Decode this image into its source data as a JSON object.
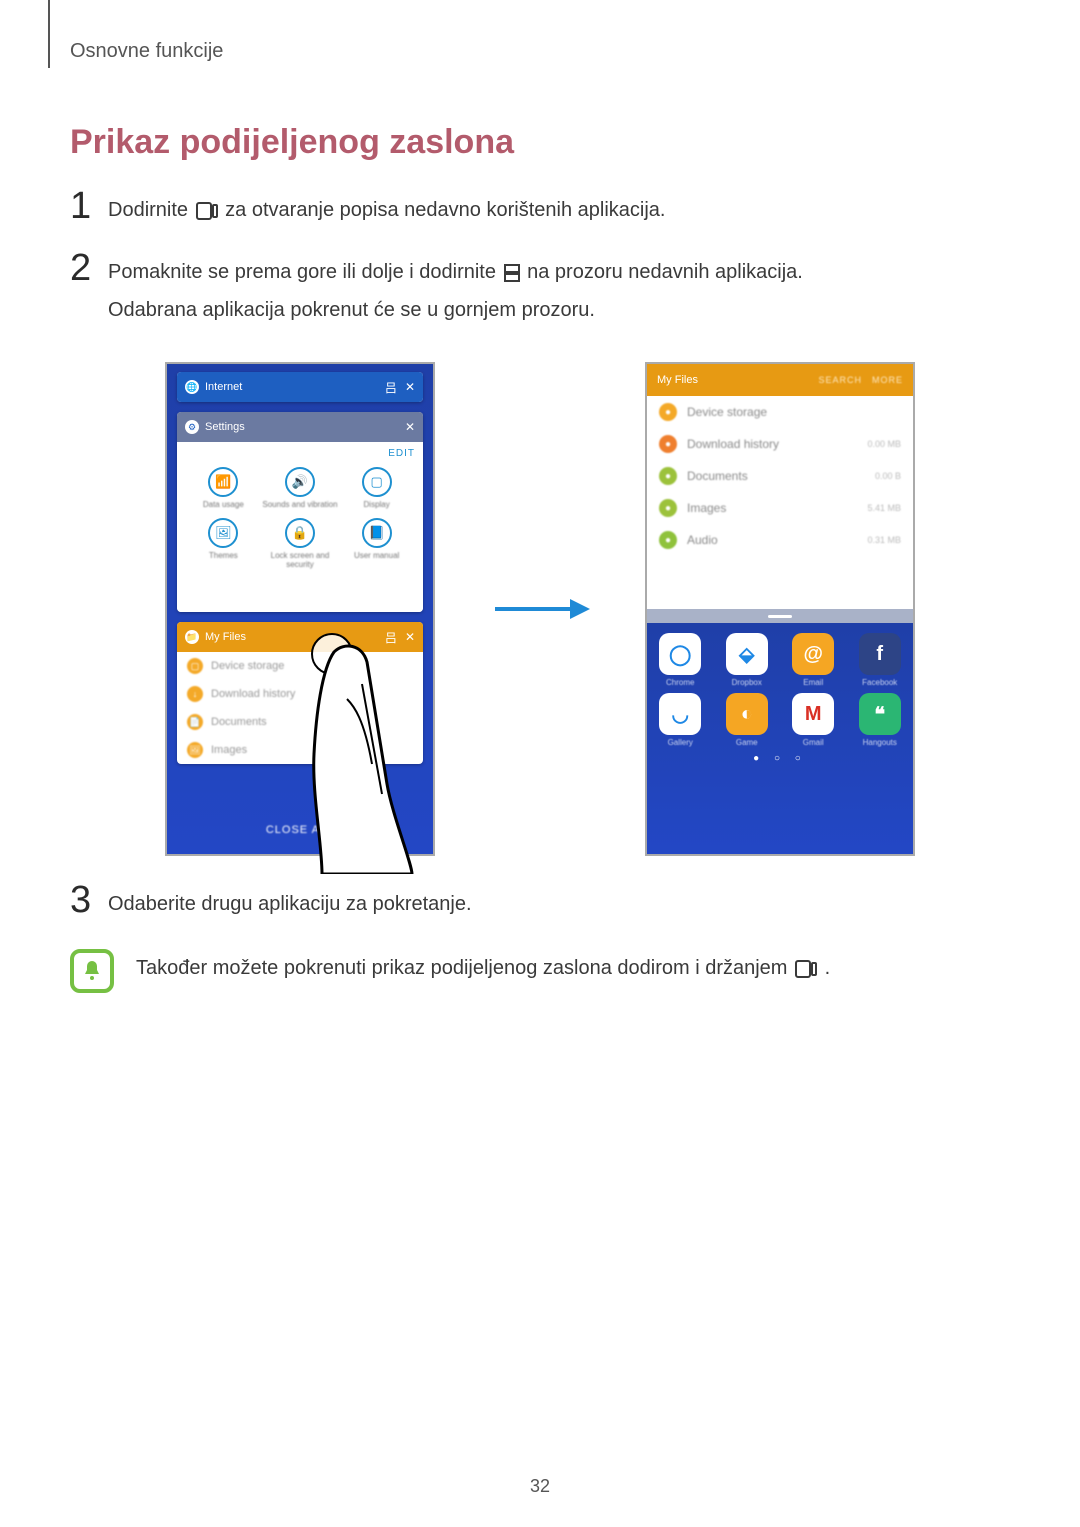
{
  "page": {
    "section_label": "Osnovne funkcije",
    "heading": "Prikaz podijeljenog zaslona",
    "page_number": "32"
  },
  "steps": {
    "s1": {
      "num": "1",
      "text_a": "Dodirnite ",
      "text_b": " za otvaranje popisa nedavno korištenih aplikacija."
    },
    "s2": {
      "num": "2",
      "line1_a": "Pomaknite se prema gore ili dolje i dodirnite ",
      "line1_b": " na prozoru nedavnih aplikacija.",
      "line2": "Odabrana aplikacija pokrenut će se u gornjem prozoru."
    },
    "s3": {
      "num": "3",
      "text": "Odaberite drugu aplikaciju za pokretanje."
    }
  },
  "tip": {
    "line_a": "Također možete pokrenuti prikaz podijeljenog zaslona dodirom i držanjem ",
    "line_b": "."
  },
  "left_phone": {
    "card1_title": "Internet",
    "card2_title": "Settings",
    "edit_label": "EDIT",
    "settings_icons": [
      {
        "glyph": "📶",
        "label": "Data usage"
      },
      {
        "glyph": "🔊",
        "label": "Sounds and vibration"
      },
      {
        "glyph": "▢",
        "label": "Display"
      },
      {
        "glyph": "🖼",
        "label": "Themes"
      },
      {
        "glyph": "🔒",
        "label": "Lock screen and security"
      },
      {
        "glyph": "📘",
        "label": "User manual"
      }
    ],
    "card3_title": "My Files",
    "files": [
      {
        "icon": "▢",
        "label": "Device storage"
      },
      {
        "icon": "↓",
        "label": "Download history"
      },
      {
        "icon": "📄",
        "label": "Documents"
      },
      {
        "icon": "🖼",
        "label": "Images"
      }
    ],
    "close_all": "CLOSE ALL"
  },
  "right_phone": {
    "files_title": "My Files",
    "action_search": "SEARCH",
    "action_more": "MORE",
    "rows": [
      {
        "label": "Device storage",
        "value": ""
      },
      {
        "label": "Download history",
        "value": "0.00 MB"
      },
      {
        "label": "Documents",
        "value": "0.00 B"
      },
      {
        "label": "Images",
        "value": "5.41 MB"
      },
      {
        "label": "Audio",
        "value": "0.31 MB"
      }
    ],
    "apps_row1": [
      {
        "name": "Chrome",
        "bg": "#ffffff",
        "glyph": "◯",
        "fg": "#1e88e5"
      },
      {
        "name": "Dropbox",
        "bg": "#ffffff",
        "glyph": "⬙",
        "fg": "#1e88e5"
      },
      {
        "name": "Email",
        "bg": "#f5a623",
        "glyph": "@",
        "fg": "#ffffff"
      },
      {
        "name": "Facebook",
        "bg": "#2d4486",
        "glyph": "f",
        "fg": "#ffffff"
      }
    ],
    "apps_row2": [
      {
        "name": "Gallery",
        "bg": "#ffffff",
        "glyph": "◡",
        "fg": "#1e88e5"
      },
      {
        "name": "Game",
        "bg": "#f5a623",
        "glyph": "◐",
        "fg": "#ffffff"
      },
      {
        "name": "Gmail",
        "bg": "#ffffff",
        "glyph": "M",
        "fg": "#d93025"
      },
      {
        "name": "Hangouts",
        "bg": "#2bb673",
        "glyph": "❝",
        "fg": "#ffffff"
      }
    ],
    "pager": "●  ○  ○"
  }
}
